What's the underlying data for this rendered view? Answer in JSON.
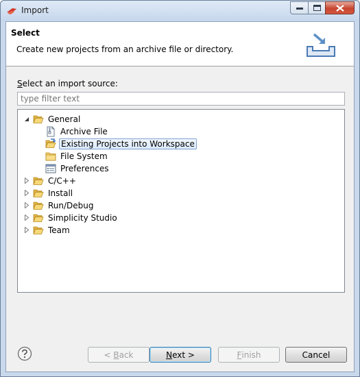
{
  "window": {
    "title": "Import"
  },
  "banner": {
    "title": "Select",
    "description": "Create new projects from an archive file or directory."
  },
  "source": {
    "label_mnemonic": "S",
    "label_rest": "elect an import source:",
    "filter_placeholder": "type filter text"
  },
  "tree": {
    "items": [
      {
        "label": "General",
        "expanded": true,
        "icon": "folder-open-icon"
      },
      {
        "label": "Archive File",
        "icon": "archive-file-icon"
      },
      {
        "label": "Existing Projects into Workspace",
        "icon": "existing-projects-icon",
        "selected": true
      },
      {
        "label": "File System",
        "icon": "folder-icon"
      },
      {
        "label": "Preferences",
        "icon": "preferences-icon"
      },
      {
        "label": "C/C++",
        "expanded": false,
        "icon": "folder-open-icon"
      },
      {
        "label": "Install",
        "expanded": false,
        "icon": "folder-open-icon"
      },
      {
        "label": "Run/Debug",
        "expanded": false,
        "icon": "folder-open-icon"
      },
      {
        "label": "Simplicity Studio",
        "expanded": false,
        "icon": "folder-open-icon"
      },
      {
        "label": "Team",
        "expanded": false,
        "icon": "folder-open-icon"
      }
    ]
  },
  "buttons": {
    "back_prefix": "< ",
    "back_mnemonic": "B",
    "back_rest": "ack",
    "next_mnemonic": "N",
    "next_rest": "ext >",
    "finish_mnemonic": "F",
    "finish_rest": "inish",
    "cancel": "Cancel"
  }
}
